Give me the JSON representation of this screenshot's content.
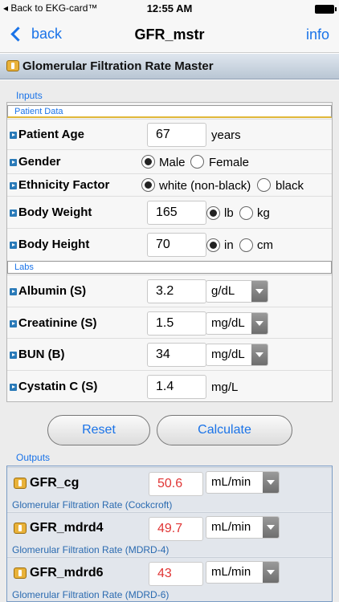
{
  "status_bar": {
    "back_app": "◂ Back to EKG-card™",
    "time": "12:55 AM"
  },
  "nav": {
    "back_label": "back",
    "title": "GFR_mstr",
    "info_label": "info"
  },
  "header": {
    "title": "Glomerular Filtration Rate Master"
  },
  "inputs": {
    "section_label": "Inputs",
    "patient_data_label": "Patient Data",
    "age": {
      "label": "Patient Age",
      "value": "67",
      "unit": "years"
    },
    "gender": {
      "label": "Gender",
      "option1": "Male",
      "option2": "Female",
      "selected": "Male"
    },
    "ethnicity": {
      "label": "Ethnicity Factor",
      "option1": "white (non-black)",
      "option2": "black",
      "selected": "white (non-black)"
    },
    "weight": {
      "label": "Body Weight",
      "value": "165",
      "option1": "lb",
      "option2": "kg",
      "selected": "lb"
    },
    "height": {
      "label": "Body Height",
      "value": "70",
      "option1": "in",
      "option2": "cm",
      "selected": "in"
    },
    "labs_label": "Labs",
    "albumin": {
      "label": "Albumin (S)",
      "value": "3.2",
      "unit": "g/dL"
    },
    "creatinine": {
      "label": "Creatinine (S)",
      "value": "1.5",
      "unit": "mg/dL"
    },
    "bun": {
      "label": "BUN (B)",
      "value": "34",
      "unit": "mg/dL"
    },
    "cystatin": {
      "label": "Cystatin C (S)",
      "value": "1.4",
      "unit": "mg/L"
    }
  },
  "buttons": {
    "reset": "Reset",
    "calculate": "Calculate"
  },
  "outputs": {
    "section_label": "Outputs",
    "gfr_cg": {
      "name": "GFR_cg",
      "value": "50.6",
      "unit": "mL/min",
      "desc": "Glomerular Filtration Rate (Cockcroft)"
    },
    "gfr_mdrd4": {
      "name": "GFR_mdrd4",
      "value": "49.7",
      "unit": "mL/min",
      "desc": "Glomerular Filtration Rate (MDRD-4)"
    },
    "gfr_mdrd6": {
      "name": "GFR_mdrd6",
      "value": "43",
      "unit": "mL/min",
      "desc": "Glomerular Filtration Rate (MDRD-6)"
    }
  },
  "colors": {
    "accent": "#1a73e8",
    "output_value": "#e03535",
    "header_icon": "#e9b23a"
  }
}
